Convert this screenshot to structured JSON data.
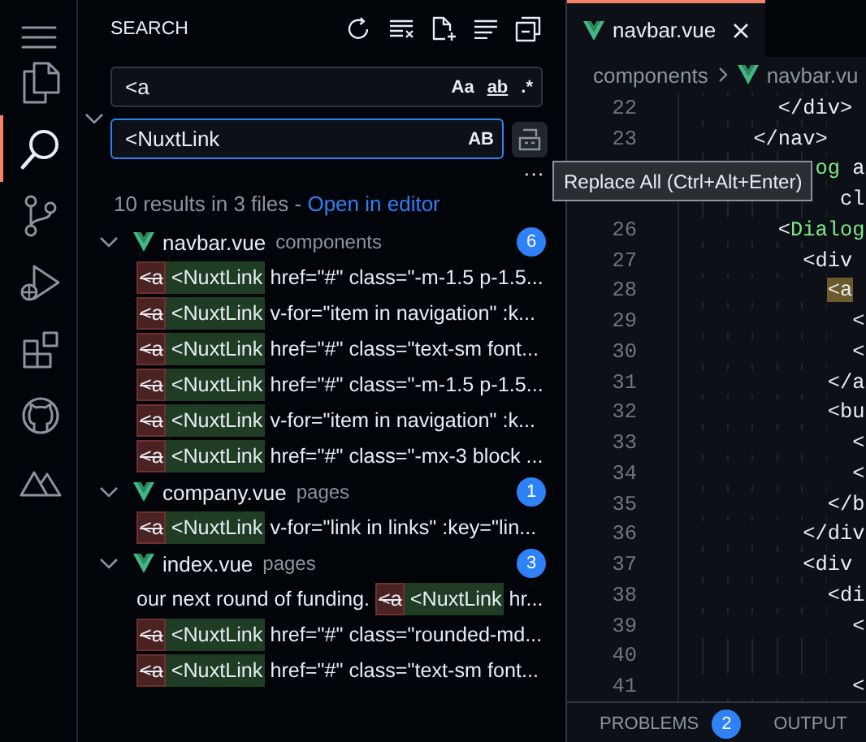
{
  "activity_bar": {
    "items": [
      {
        "kind": "files",
        "selected": false
      },
      {
        "kind": "search",
        "selected": true
      },
      {
        "kind": "branch",
        "selected": false
      },
      {
        "kind": "debug",
        "selected": false
      },
      {
        "kind": "extensions",
        "selected": false
      },
      {
        "kind": "cat",
        "selected": false
      },
      {
        "kind": "mountain",
        "selected": false
      }
    ]
  },
  "search": {
    "title": "SEARCH",
    "replace_expanded": true,
    "find": {
      "value": "<a",
      "options": [
        "Aa",
        "ab",
        ".*"
      ]
    },
    "replace": {
      "value": "<NuxtLink",
      "option": "AB"
    },
    "more": "···",
    "tooltip": "Replace All (Ctrl+Alt+Enter)",
    "summary": "10 results in 3 files - ",
    "open_link": "Open in editor",
    "files": [
      {
        "name": "navbar.vue",
        "folder": "components",
        "count": "6",
        "expanded": true,
        "matches": [
          {
            "removed": "<a",
            "added": "<NuxtLink",
            "after": " href=\"#\" class=\"-m-1.5 p-1.5..."
          },
          {
            "removed": "<a",
            "added": "<NuxtLink",
            "after": " v-for=\"item in navigation\" :k..."
          },
          {
            "removed": "<a",
            "added": "<NuxtLink",
            "after": " href=\"#\" class=\"text-sm font..."
          },
          {
            "removed": "<a",
            "added": "<NuxtLink",
            "after": " href=\"#\" class=\"-m-1.5 p-1.5..."
          },
          {
            "removed": "<a",
            "added": "<NuxtLink",
            "after": " v-for=\"item in navigation\" :k..."
          },
          {
            "removed": "<a",
            "added": "<NuxtLink",
            "after": " href=\"#\" class=\"-mx-3 block ..."
          }
        ]
      },
      {
        "name": "company.vue",
        "folder": "pages",
        "count": "1",
        "expanded": true,
        "matches": [
          {
            "removed": "<a",
            "added": "<NuxtLink",
            "after": " v-for=\"link in links\" :key=\"lin..."
          }
        ]
      },
      {
        "name": "index.vue",
        "folder": "pages",
        "count": "3",
        "expanded": true,
        "matches": [
          {
            "before": "our next round of funding. ",
            "removed": "<a",
            "added": "<NuxtLink",
            "after": " hr..."
          },
          {
            "removed": "<a",
            "added": "<NuxtLink",
            "after": " href=\"#\" class=\"rounded-md..."
          },
          {
            "removed": "<a",
            "added": "<NuxtLink",
            "after": " href=\"#\" class=\"text-sm font..."
          }
        ]
      }
    ]
  },
  "editor": {
    "tabs": [
      {
        "label": "navbar.vue",
        "selected": true
      }
    ],
    "breadcrumbs": [
      "components",
      "navbar.vu"
    ],
    "lines": [
      {
        "number": "22",
        "parts": [
          {
            "text": "        </div>",
            "kind": "tag"
          }
        ]
      },
      {
        "number": "23",
        "parts": [
          {
            "text": "      </nav>",
            "kind": "tag"
          }
        ]
      },
      {
        "covered_start": true,
        "parts": [
          {
            "text": "og",
            "kind": "component"
          },
          {
            "text": " a",
            "kind": "tag"
          }
        ]
      },
      {
        "covered_start": true,
        "parts": [
          {
            "text": "  cl",
            "kind": "tag"
          }
        ]
      },
      {
        "number": "26",
        "parts": [
          {
            "text": "        <",
            "kind": "tag"
          },
          {
            "text": "Dialog",
            "kind": "component"
          }
        ]
      },
      {
        "number": "27",
        "parts": [
          {
            "text": "          <div",
            "kind": "tag"
          }
        ]
      },
      {
        "number": "28",
        "parts": [
          {
            "text": "            <a",
            "kind": "match"
          }
        ]
      },
      {
        "number": "29",
        "parts": [
          {
            "text": "              <",
            "kind": "tag"
          }
        ]
      },
      {
        "number": "30",
        "parts": [
          {
            "text": "              <",
            "kind": "tag"
          }
        ]
      },
      {
        "number": "31",
        "parts": [
          {
            "text": "            </a",
            "kind": "tag"
          }
        ]
      },
      {
        "number": "32",
        "parts": [
          {
            "text": "            <bu",
            "kind": "tag"
          }
        ]
      },
      {
        "number": "33",
        "parts": [
          {
            "text": "              <",
            "kind": "tag"
          }
        ]
      },
      {
        "number": "34",
        "parts": [
          {
            "text": "              <",
            "kind": "tag"
          }
        ]
      },
      {
        "number": "35",
        "parts": [
          {
            "text": "            </b",
            "kind": "tag"
          }
        ]
      },
      {
        "number": "36",
        "parts": [
          {
            "text": "          </div",
            "kind": "tag"
          }
        ]
      },
      {
        "number": "37",
        "parts": [
          {
            "text": "          <div",
            "kind": "tag"
          }
        ]
      },
      {
        "number": "38",
        "parts": [
          {
            "text": "            <di",
            "kind": "tag"
          }
        ]
      },
      {
        "number": "39",
        "parts": [
          {
            "text": "              <",
            "kind": "tag"
          }
        ]
      },
      {
        "number": "40"
      },
      {
        "number": "41",
        "parts": [
          {
            "text": "              <",
            "kind": "tag"
          }
        ]
      }
    ]
  },
  "panel": {
    "tabs": [
      {
        "label": "PROBLEMS",
        "badge": "2"
      },
      {
        "label": "OUTPUT"
      }
    ]
  }
}
